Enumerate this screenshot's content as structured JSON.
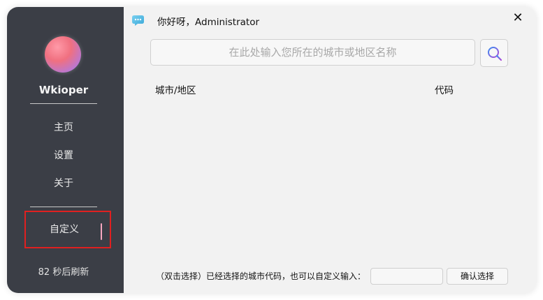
{
  "sidebar": {
    "username": "Wkioper",
    "nav": {
      "home": "主页",
      "settings": "设置",
      "about": "关于",
      "custom": "自定义"
    },
    "refresh_text": "82 秒后刷新"
  },
  "header": {
    "greeting": "你好呀，Administrator",
    "close_glyph": "✕"
  },
  "search": {
    "placeholder": "在此处输入您所在的城市或地区名称",
    "value": ""
  },
  "table": {
    "columns": [
      "城市/地区",
      "代码"
    ],
    "rows": []
  },
  "footer": {
    "label": "（双击选择）已经选择的城市代码，也可以自定义输入：",
    "custom_code_value": "",
    "confirm_label": "确认选择"
  },
  "colors": {
    "sidebar_bg": "#3b3e46",
    "main_bg": "#f2f2f2",
    "highlight_border": "#e02020",
    "active_indicator": "#f7a7c0",
    "search_icon_gradient": [
      "#3b8cf0",
      "#b04ad8"
    ]
  },
  "icons": {
    "app": "chat-bubble-icon",
    "search": "search-icon",
    "close": "close-icon",
    "avatar": "avatar-gradient"
  }
}
